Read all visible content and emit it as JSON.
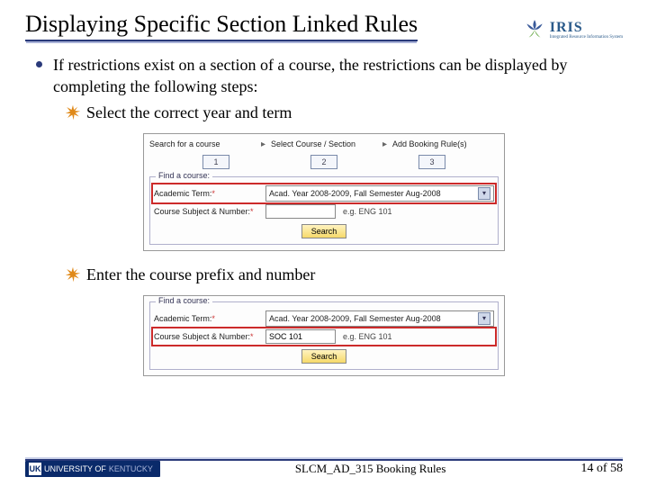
{
  "title": "Displaying Specific Section Linked Rules",
  "logo_name": "IRIS",
  "logo_tagline": "Integrated Resource Information System",
  "bullet": "If restrictions exist on a section of a course, the restrictions can be displayed by completing the following steps:",
  "sub1": "Select the correct year and term",
  "sub2": "Enter the course prefix and number",
  "panel1": {
    "steps": {
      "s1": "Search for a course",
      "s2": "Select Course / Section",
      "s3": "Add Booking Rule(s)"
    },
    "boxes": {
      "b1": "1",
      "b2": "2",
      "b3": "3"
    },
    "legend": "Find a course:",
    "row1_label": "Academic Term:",
    "row1_value": "Acad. Year 2008-2009, Fall Semester Aug-2008",
    "row2_label": "Course Subject & Number:",
    "row2_value": "",
    "row2_hint": "e.g. ENG 101",
    "search": "Search"
  },
  "panel2": {
    "legend": "Find a course:",
    "row1_label": "Academic Term:",
    "row1_value": "Acad. Year 2008-2009, Fall Semester Aug-2008",
    "row2_label": "Course Subject & Number:",
    "row2_value": "SOC 101",
    "row2_hint": "e.g. ENG 101",
    "search": "Search"
  },
  "footer": {
    "uk_bold": "UNIVERSITY OF",
    "uk_gray": "KENTUCKY",
    "center": "SLCM_AD_315 Booking Rules",
    "page": "14 of 58"
  }
}
